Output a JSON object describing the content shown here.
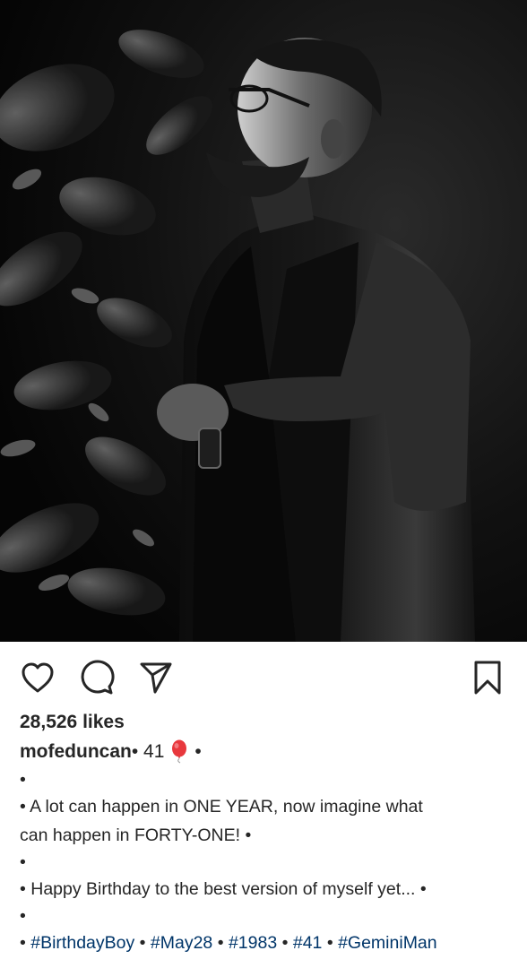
{
  "post": {
    "image_alt_icon": "portrait-photo",
    "likes": "28,526 likes",
    "username": "mofeduncan",
    "header_suffix_a": " • 41",
    "header_suffix_b": " •",
    "caption": {
      "dot": "•",
      "line1": "• A lot can happen in ONE YEAR, now imagine what",
      "line2": "can happen in FORTY-ONE! •",
      "line3": "• Happy Birthday to the best version of myself yet... •",
      "bullet": "• ",
      "sep": " • ",
      "hashtags": [
        "#BirthdayBoy",
        "#May28",
        "#1983",
        "#41",
        "#GeminiMan"
      ]
    }
  },
  "icons": {
    "like": "heart-icon",
    "comment": "comment-icon",
    "share": "send-icon",
    "save": "bookmark-icon",
    "balloon": "balloon-emoji-icon"
  },
  "colors": {
    "text": "#262626",
    "hashtag": "#003569",
    "balloon": "#e8383d"
  }
}
